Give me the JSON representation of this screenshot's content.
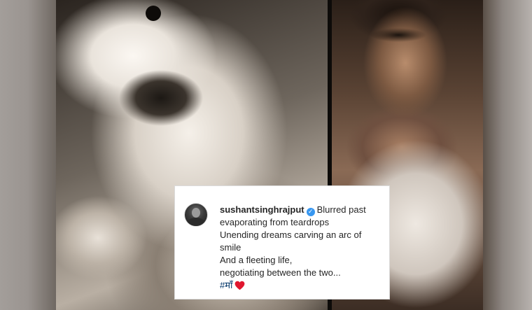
{
  "post": {
    "username": "sushantsinghrajput",
    "caption_lines": [
      "Blurred past",
      "evaporating from teardrops",
      "Unending dreams carving an arc of",
      "smile",
      "And a fleeting life,",
      "negotiating between the two..."
    ],
    "hashtag": "#माँ",
    "icons": {
      "verified": "verified-badge-icon",
      "heart": "red-heart-icon"
    },
    "colors": {
      "verified": "#3897f0",
      "hashtag": "#003569",
      "heart": "#e0172f",
      "text": "#262626"
    }
  }
}
